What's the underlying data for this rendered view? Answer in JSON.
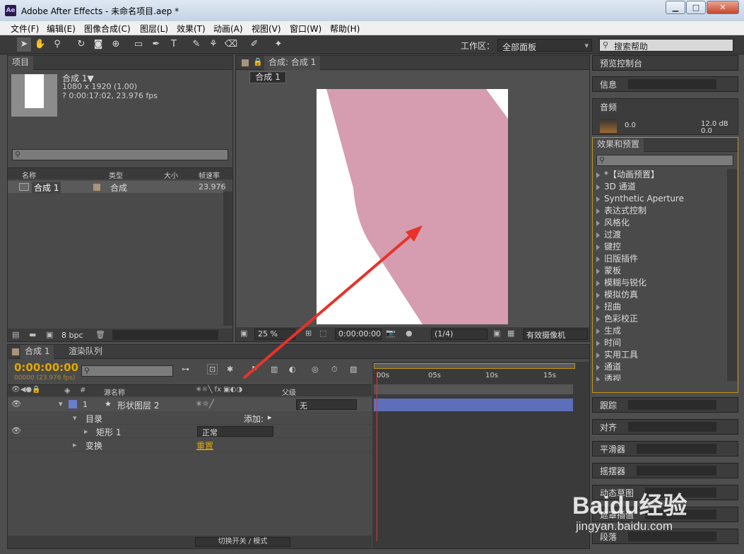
{
  "window": {
    "title": "Adobe After Effects - 未命名项目.aep *",
    "logo": "Ae"
  },
  "menu": [
    "文件(F)",
    "编辑(E)",
    "图像合成(C)",
    "图层(L)",
    "效果(T)",
    "动画(A)",
    "视图(V)",
    "窗口(W)",
    "帮助(H)"
  ],
  "toolbar": {
    "workspace_label": "工作区：",
    "workspace_value": "全部面板",
    "search_placeholder": "搜索帮助"
  },
  "project": {
    "tab": "项目",
    "comp_name": "合成 1▼",
    "comp_size": "1080 x 1920 (1.00)",
    "comp_duration": "? 0:00:17:02, 23.976 fps",
    "columns": [
      "名称",
      "类型",
      "大小",
      "帧速率"
    ],
    "row": {
      "name": "合成 1",
      "type": "合成",
      "rate": "23.976"
    },
    "bpc": "8 bpc"
  },
  "viewer": {
    "tab": "合成: 合成 1",
    "sub_tab": "合成 1",
    "zoom": "25 %",
    "timecode": "0:00:00:00",
    "resolution": "(1/4)",
    "camera": "有效摄像机"
  },
  "timeline": {
    "tabs": [
      "合成 1",
      "渲染队列"
    ],
    "timecode": "0:00:00:00",
    "frames": "00000 (23.976 fps)",
    "col_source": "源名称",
    "col_parent": "父级",
    "ticks": [
      "00s",
      "05s",
      "10s",
      "15s"
    ],
    "layer": {
      "num": "1",
      "name": "形状图层 2",
      "parent": "无"
    },
    "props": [
      {
        "label": "目录",
        "extra": "添加:"
      },
      {
        "label": "矩形 1",
        "extra": "正常"
      },
      {
        "label": "变换",
        "extra": "重置"
      }
    ],
    "footer": "切换开关 / 模式"
  },
  "right_panels": {
    "preview": "预览控制台",
    "info": "信息",
    "audio": "音频",
    "audio_left": "0.0",
    "audio_right": "12.0 dB",
    "audio_right2": "0.0",
    "effects": "效果和预置",
    "effects_list": [
      "*【动画预置】",
      "3D 通道",
      "Synthetic Aperture",
      "表达式控制",
      "风格化",
      "过渡",
      "键控",
      "旧版插件",
      "蒙板",
      "模糊与锐化",
      "模拟仿真",
      "扭曲",
      "色彩校正",
      "生成",
      "时间",
      "实用工具",
      "通道",
      "透视"
    ],
    "bottom": [
      "跟踪",
      "对齐",
      "平滑器",
      "摇摆器",
      "动态草图",
      "遮罩插值",
      "段落"
    ]
  },
  "watermark": {
    "brand": "Baidu经验",
    "url": "jingyan.baidu.com"
  }
}
